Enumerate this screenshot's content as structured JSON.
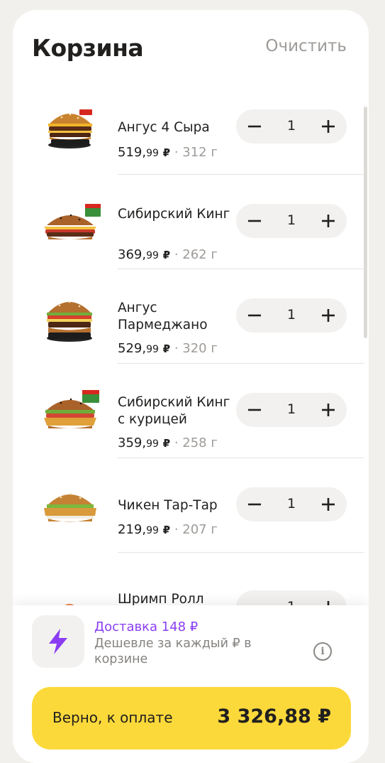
{
  "cart": {
    "title": "Корзина",
    "clear_label": "Очистить"
  },
  "items": [
    {
      "name": "Ангус 4 Сыра",
      "price_int": "519,",
      "price_frac": "99",
      "currency": "₽",
      "weight": "· 312 г",
      "qty": "1",
      "image": "angus-4-cheese-burger"
    },
    {
      "name": "Сибирский Кинг",
      "price_int": "369,",
      "price_frac": "99",
      "currency": "₽",
      "weight": "· 262 г",
      "qty": "1",
      "image": "siberian-king-burger"
    },
    {
      "name": "Ангус Пармеджано",
      "price_int": "529,",
      "price_frac": "99",
      "currency": "₽",
      "weight": "· 320 г",
      "qty": "1",
      "image": "angus-parmigiano-burger"
    },
    {
      "name": "Сибирский Кинг с курицей",
      "price_int": "359,",
      "price_frac": "99",
      "currency": "₽",
      "weight": "· 258 г",
      "qty": "1",
      "image": "siberian-king-chicken-burger"
    },
    {
      "name": "Чикен Тар-Тар",
      "price_int": "219,",
      "price_frac": "99",
      "currency": "₽",
      "weight": "· 207 г",
      "qty": "1",
      "image": "chicken-tartar-burger"
    },
    {
      "name": "Шримп Ролл",
      "price_int": "",
      "price_frac": "",
      "currency": "",
      "weight": "",
      "qty": "1",
      "image": "shrimp-roll"
    }
  ],
  "delivery": {
    "title": "Доставка 148 ₽",
    "subtitle": "Дешевле за каждый ₽ в корзине",
    "accent_color": "#8a3df2"
  },
  "checkout": {
    "label": "Верно, к оплате",
    "total": "3 326,88 ₽",
    "button_color": "#fcd93a"
  },
  "icons": {
    "minus": "minus-icon",
    "plus": "plus-icon",
    "bolt": "lightning-bolt-icon",
    "info": "info-icon"
  }
}
